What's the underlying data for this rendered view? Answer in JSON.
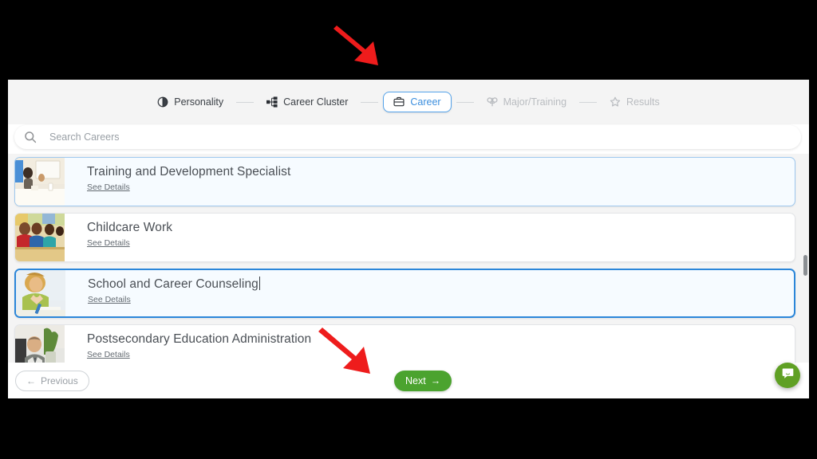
{
  "stepper": {
    "steps": [
      {
        "label": "Personality",
        "icon": "contrast-icon",
        "state": "done"
      },
      {
        "label": "Career Cluster",
        "icon": "sitemap-icon",
        "state": "done"
      },
      {
        "label": "Career",
        "icon": "briefcase-icon",
        "state": "active"
      },
      {
        "label": "Major/Training",
        "icon": "graduation-icon",
        "state": "future"
      },
      {
        "label": "Results",
        "icon": "star-icon",
        "state": "future"
      }
    ]
  },
  "search": {
    "placeholder": "Search Careers",
    "value": "",
    "icon": "search-icon"
  },
  "list": {
    "see_details_label": "See Details",
    "items": [
      {
        "title": "Training and Development Specialist",
        "state": "sel-soft",
        "thumb": "training-room-photo"
      },
      {
        "title": "Childcare Work",
        "state": "normal",
        "thumb": "children-classroom-photo"
      },
      {
        "title": "School and Career Counseling",
        "state": "sel-hard",
        "thumb": "counselor-woman-photo"
      },
      {
        "title": "Postsecondary Education Administration",
        "state": "normal",
        "thumb": "administrator-man-photo"
      }
    ]
  },
  "footer": {
    "previous_label": "Previous",
    "next_label": "Next",
    "next_color": "#4ba32f"
  },
  "chat": {
    "icon": "chat-bubble-icon",
    "color": "#5fa024"
  },
  "annotations": {
    "arrow_color": "#ee1c1c",
    "arrows": [
      {
        "name": "arrow-pointing-to-career-tab"
      },
      {
        "name": "arrow-pointing-to-next-button"
      }
    ]
  },
  "colors": {
    "accent_blue": "#3b8ede",
    "selected_border": "#2b86d9",
    "page_bg": "#f4f4f4"
  }
}
